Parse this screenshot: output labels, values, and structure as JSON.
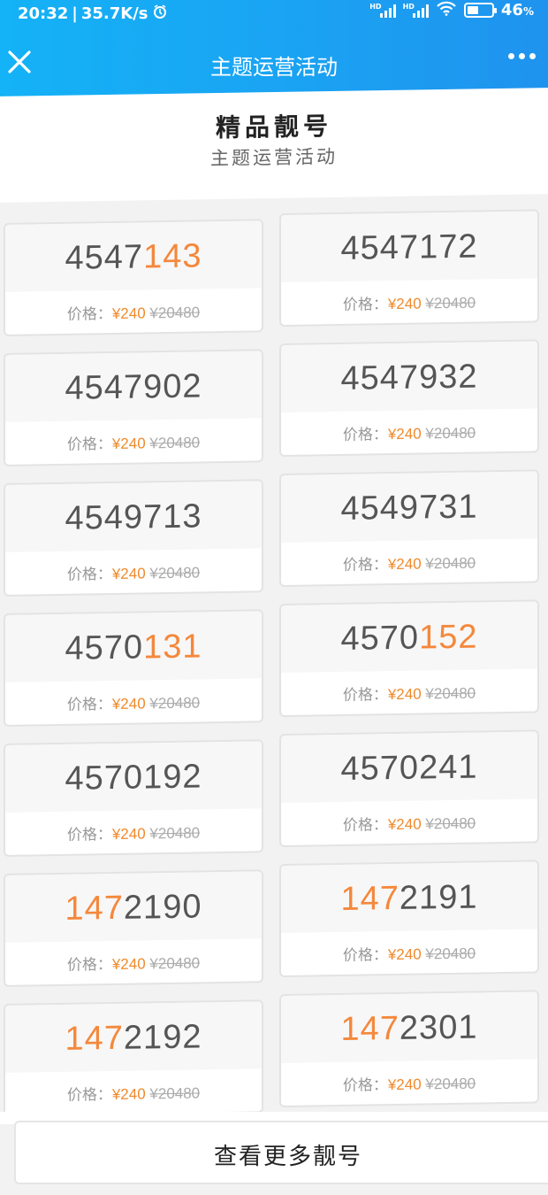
{
  "status_bar": {
    "time": "20:32",
    "speed": "35.7K/s",
    "hd1": "HD",
    "hd2": "HD",
    "battery": "46",
    "battery_unit": "%",
    "battery_level": 0.46
  },
  "navbar": {
    "title": "主题运营活动"
  },
  "heading": {
    "title": "精品靓号",
    "subtitle": "主题运营活动"
  },
  "price_label": "价格：",
  "cards": [
    {
      "plain": "4547",
      "highlight": "143",
      "tail": "",
      "price": "¥240",
      "original": "¥20480"
    },
    {
      "plain": "4547172",
      "highlight": "",
      "tail": "",
      "price": "¥240",
      "original": "¥20480"
    },
    {
      "plain": "4547902",
      "highlight": "",
      "tail": "",
      "price": "¥240",
      "original": "¥20480"
    },
    {
      "plain": "4547932",
      "highlight": "",
      "tail": "",
      "price": "¥240",
      "original": "¥20480"
    },
    {
      "plain": "4549713",
      "highlight": "",
      "tail": "",
      "price": "¥240",
      "original": "¥20480"
    },
    {
      "plain": "4549731",
      "highlight": "",
      "tail": "",
      "price": "¥240",
      "original": "¥20480"
    },
    {
      "plain": "4570",
      "highlight": "131",
      "tail": "",
      "price": "¥240",
      "original": "¥20480"
    },
    {
      "plain": "4570",
      "highlight": "152",
      "tail": "",
      "price": "¥240",
      "original": "¥20480"
    },
    {
      "plain": "4570192",
      "highlight": "",
      "tail": "",
      "price": "¥240",
      "original": "¥20480"
    },
    {
      "plain": "4570241",
      "highlight": "",
      "tail": "",
      "price": "¥240",
      "original": "¥20480"
    },
    {
      "plain": "",
      "highlight": "147",
      "tail": "2190",
      "price": "¥240",
      "original": "¥20480"
    },
    {
      "plain": "",
      "highlight": "147",
      "tail": "2191",
      "price": "¥240",
      "original": "¥20480"
    },
    {
      "plain": "",
      "highlight": "147",
      "tail": "2192",
      "price": "¥240",
      "original": "¥20480"
    },
    {
      "plain": "",
      "highlight": "147",
      "tail": "2301",
      "price": "¥240",
      "original": "¥20480"
    }
  ],
  "footer": {
    "more_button": "查看更多靓号"
  }
}
